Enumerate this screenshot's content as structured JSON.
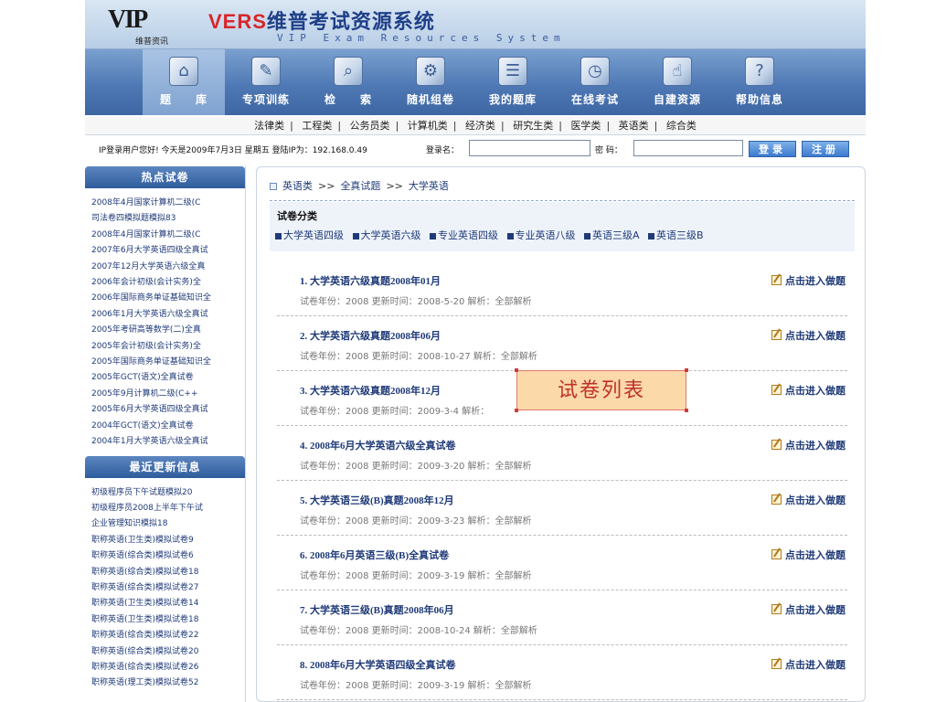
{
  "header": {
    "logo_text": "VIP",
    "logo_sub": "维普资讯",
    "title_brand": "VERS",
    "title_main": "维普考试资源系统",
    "subtitle": "VIP Exam Resources System"
  },
  "nav": {
    "items": [
      {
        "label": "题　　库",
        "icon": "library-icon",
        "glyph": "⌂"
      },
      {
        "label": "专项训练",
        "icon": "training-icon",
        "glyph": "✎"
      },
      {
        "label": "检　　索",
        "icon": "search-icon",
        "glyph": "⌕"
      },
      {
        "label": "随机组卷",
        "icon": "random-paper-icon",
        "glyph": "⚙"
      },
      {
        "label": "我的题库",
        "icon": "my-library-icon",
        "glyph": "☰"
      },
      {
        "label": "在线考试",
        "icon": "clock-icon",
        "glyph": "◷"
      },
      {
        "label": "自建资源",
        "icon": "hand-pointer-icon",
        "glyph": "☝"
      },
      {
        "label": "帮助信息",
        "icon": "help-icon",
        "glyph": "?"
      }
    ]
  },
  "categories": [
    "法律类",
    "工程类",
    "公务员类",
    "计算机类",
    "经济类",
    "研究生类",
    "医学类",
    "英语类",
    "综合类"
  ],
  "login": {
    "welcome": "IP登录用户您好! 今天是2009年7月3日 星期五 登陆IP为：192.168.0.49",
    "username_label": "登录名：",
    "password_label": "密  码：",
    "username_value": "",
    "password_value": "",
    "login_button": "登录",
    "register_button": "注册"
  },
  "sidebar": {
    "hot_title": "热点试卷",
    "hot_items": [
      "2008年4月国家计算机二级(C",
      "司法卷四模拟题模拟83",
      "2008年4月国家计算机二级(C",
      "2007年6月大学英语四级全真试",
      "2007年12月大学英语六级全真",
      "2006年会计初级(会计实务)全",
      "2006年国际商务单证基础知识全",
      "2006年1月大学英语六级全真试",
      "2005年考研高等数学(二)全真",
      "2005年会计初级(会计实务)全",
      "2005年国际商务单证基础知识全",
      "2005年GCT(语文)全真试卷",
      "2005年9月计算机二级(C++",
      "2005年6月大学英语四级全真试",
      "2004年GCT(语文)全真试卷",
      "2004年1月大学英语六级全真试"
    ],
    "recent_title": "最近更新信息",
    "recent_items": [
      "初级程序员下午试题模拟20",
      "初级程序员2008上半年下午试",
      "企业管理知识模拟18",
      "职称英语(卫生类)模拟试卷9",
      "职称英语(综合类)模拟试卷6",
      "职称英语(综合类)模拟试卷18",
      "职称英语(综合类)模拟试卷27",
      "职称英语(卫生类)模拟试卷14",
      "职称英语(卫生类)模拟试卷18",
      "职称英语(综合类)模拟试卷22",
      "职称英语(综合类)模拟试卷20",
      "职称英语(综合类)模拟试卷26",
      "职称英语(理工类)模拟试卷52"
    ]
  },
  "main": {
    "breadcrumb": [
      "英语类",
      "全真试题",
      "大学英语"
    ],
    "breadcrumb_sep": ">>",
    "classify_title": "试卷分类",
    "classify_links": [
      "大学英语四级",
      "大学英语六级",
      "专业英语四级",
      "专业英语八级",
      "英语三级A",
      "英语三级B"
    ],
    "papers": [
      {
        "title": "1. 大学英语六级真题2008年01月",
        "meta": "试卷年份：2008 更新时间：2008-5-20 解析：全部解析",
        "action": "点击进入做题"
      },
      {
        "title": "2. 大学英语六级真题2008年06月",
        "meta": "试卷年份：2008 更新时间：2008-10-27 解析：全部解析",
        "action": "点击进入做题"
      },
      {
        "title": "3. 大学英语六级真题2008年12月",
        "meta": "试卷年份：2008 更新时间：2009-3-4 解析：",
        "action": "点击进入做题"
      },
      {
        "title": "4. 2008年6月大学英语六级全真试卷",
        "meta": "试卷年份：2008 更新时间：2009-3-20 解析：全部解析",
        "action": "点击进入做题"
      },
      {
        "title": "5. 大学英语三级(B)真题2008年12月",
        "meta": "试卷年份：2008 更新时间：2009-3-23 解析：全部解析",
        "action": "点击进入做题"
      },
      {
        "title": "6. 2008年6月英语三级(B)全真试卷",
        "meta": "试卷年份：2008 更新时间：2009-3-19 解析：全部解析",
        "action": "点击进入做题"
      },
      {
        "title": "7. 大学英语三级(B)真题2008年06月",
        "meta": "试卷年份：2008 更新时间：2008-10-24 解析：全部解析",
        "action": "点击进入做题"
      },
      {
        "title": "8. 2008年6月大学英语四级全真试卷",
        "meta": "试卷年份：2008 更新时间：2009-3-19 解析：全部解析",
        "action": "点击进入做题"
      }
    ]
  },
  "callout": {
    "text": "试卷列表"
  },
  "colors": {
    "brand_blue": "#1f3f88",
    "brand_red": "#d8262a",
    "link": "#1f3a78"
  }
}
